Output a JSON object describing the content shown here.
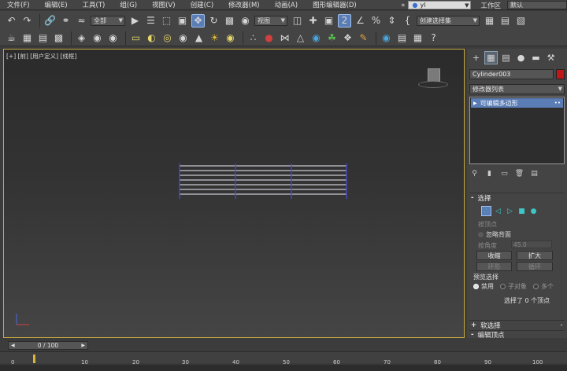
{
  "menubar": {
    "items": [
      "文件(F)",
      "编辑(E)",
      "工具(T)",
      "组(G)",
      "视图(V)",
      "创建(C)",
      "修改器(M)",
      "动画(A)",
      "图形编辑器(D)"
    ],
    "overflow": "»",
    "user": "yl",
    "workspace_label": "工作区",
    "workspace_value": "默认"
  },
  "toolbar": {
    "filter_dropdown": "全部",
    "refcoord_dropdown": "视图",
    "selection_set": "创建选择集"
  },
  "viewport": {
    "label": "[+] [前] [用户定义] [线框]"
  },
  "command_panel": {
    "object_name": "Cylinder003",
    "object_color": "#c01818",
    "modifier_list": "修改器列表",
    "stack_item": "可编辑多边形",
    "rollouts": {
      "selection": "选择",
      "soft_selection": "软选择",
      "edit_vertices": "编辑顶点"
    },
    "options": {
      "by_vertex": "按顶点",
      "ignore_backfacing": "忽略背面",
      "by_angle": "按角度",
      "angle_value": "45.0",
      "shrink": "收缩",
      "grow": "扩大",
      "ring": "环形",
      "loop": "循环"
    },
    "preview": {
      "label": "预览选择",
      "off": "禁用",
      "subobject": "子对象",
      "multi": "多个"
    },
    "status": "选择了 0 个顶点"
  },
  "timeslider": {
    "value": "0 / 100"
  },
  "trackbar": {
    "ticks": [
      "0",
      "10",
      "20",
      "30",
      "40",
      "50",
      "60",
      "70",
      "80",
      "90",
      "100"
    ]
  },
  "colors": {
    "accent": "#5a7db5",
    "viewport_border": "#c8a840",
    "wire": "#4848c8"
  }
}
